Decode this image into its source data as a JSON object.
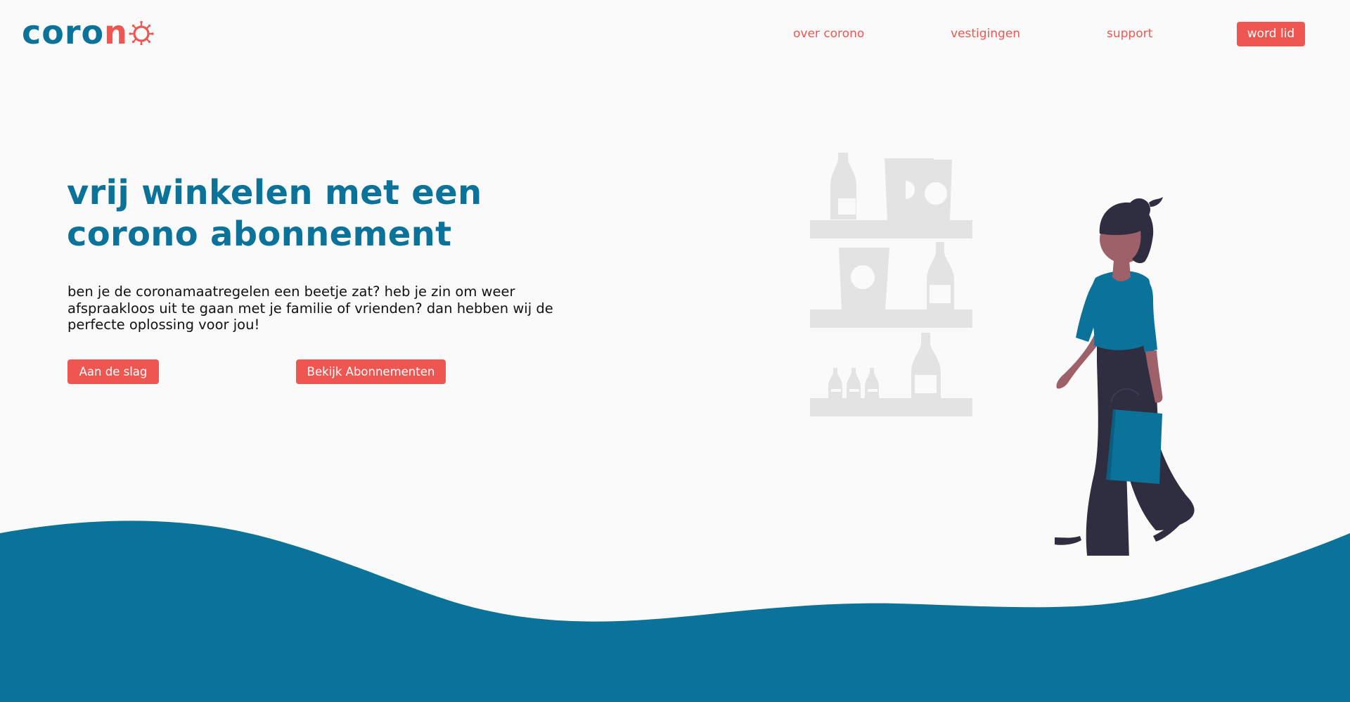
{
  "header": {
    "logo": {
      "text_main": "coro",
      "text_accent": "n",
      "icon": "virus-o-icon"
    },
    "nav": [
      {
        "label": "over corono"
      },
      {
        "label": "vestigingen"
      },
      {
        "label": "support"
      }
    ],
    "cta_label": "word lid"
  },
  "hero": {
    "title": "vrij winkelen met een corono abonnement",
    "text": "ben je de coronamaatregelen een beetje zat? heb je zin om weer afspraakloos uit te gaan met je familie of vrienden? dan hebben wij de perfecte oplossing voor jou!",
    "buttons": [
      {
        "label": "Aan de slag"
      },
      {
        "label": "Bekijk Abonnementen"
      }
    ]
  },
  "illustration": {
    "icons": [
      "store-shelves-icon",
      "woman-shopping-icon",
      "shopping-bag-icon"
    ]
  },
  "colors": {
    "brand_blue": "#0b7399",
    "accent_red": "#ee5652",
    "background": "#fafafa",
    "shelf_gray": "#e3e3e3",
    "figure_dark": "#2f2e41",
    "skin": "#9e616a"
  }
}
